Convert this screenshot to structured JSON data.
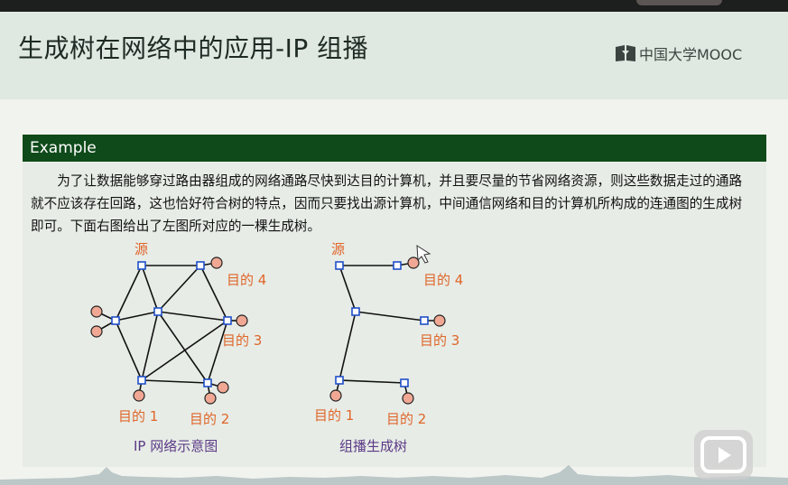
{
  "slide": {
    "title": "生成树在网络中的应用-IP 组播",
    "logo_text": "中国大学MOOC",
    "logo_icon": "mooc-book-icon"
  },
  "example": {
    "header": "Example",
    "paragraph": "为了让数据能够穿过路由器组成的网络通路尽快到达目的计算机，并且要尽量的节省网络资源，则这些数据走过的通路就不应该存在回路，这也恰好符合树的特点，因而只要找出源计算机，中间通信网络和目的计算机所构成的连通图的生成树即可。下面右图给出了左图所对应的一棵生成树。"
  },
  "diagram_left": {
    "caption": "IP 网络示意图",
    "source_label": "源",
    "dest1": "目的 1",
    "dest2": "目的 2",
    "dest3": "目的 3",
    "dest4": "目的 4"
  },
  "diagram_right": {
    "caption": "组播生成树",
    "source_label": "源",
    "dest1": "目的 1",
    "dest2": "目的 2",
    "dest3": "目的 3",
    "dest4": "目的 4"
  },
  "colors": {
    "header_green": "#0f4a1a",
    "label_orange": "#e0662a",
    "caption_purple": "#5b3a86",
    "router_blue": "#1f4fc9",
    "host_fill": "#f0a894"
  },
  "overlay": {
    "play_icon": "play-icon"
  }
}
